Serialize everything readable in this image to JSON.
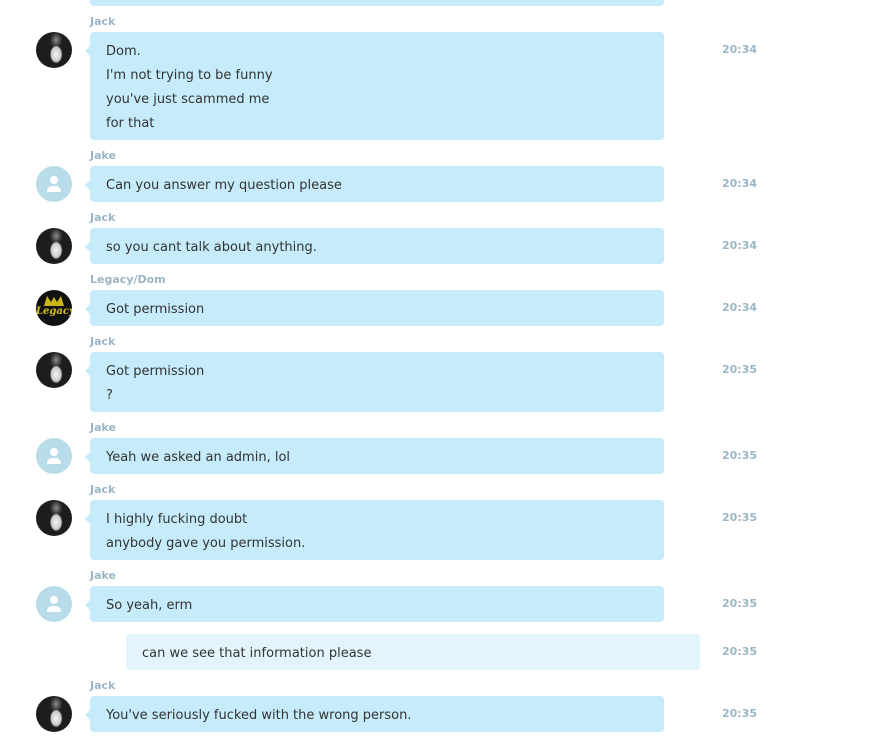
{
  "colors": {
    "bubble": "#c6ebfa",
    "own_bubble": "#e3f4fc",
    "meta_text": "#9ab5c6",
    "message_text": "#333333"
  },
  "messages": [
    {
      "sender": "Jack",
      "time": "20:34",
      "lines": [
        "Dom.",
        "I'm not trying to be funny",
        "you've just scammed me",
        "for that"
      ]
    },
    {
      "sender": "Jake",
      "time": "20:34",
      "lines": [
        "Can you answer my question please"
      ]
    },
    {
      "sender": "Jack",
      "time": "20:34",
      "lines": [
        "so you cant talk about anything."
      ]
    },
    {
      "sender": "Legacy/Dom",
      "avatar_text": "Legacy",
      "time": "20:34",
      "lines": [
        "Got permission"
      ]
    },
    {
      "sender": "Jack",
      "time": "20:35",
      "lines": [
        "Got permission",
        "?"
      ]
    },
    {
      "sender": "Jake",
      "time": "20:35",
      "lines": [
        "Yeah we asked an admin, lol"
      ]
    },
    {
      "sender": "Jack",
      "time": "20:35",
      "lines": [
        "I highly fucking doubt",
        "anybody gave you permission."
      ]
    },
    {
      "sender": "Jake",
      "time": "20:35",
      "lines": [
        "So yeah, erm"
      ]
    },
    {
      "time": "20:35",
      "lines": [
        "can we see that information please"
      ]
    },
    {
      "sender": "Jack",
      "time": "20:35",
      "lines": [
        "You've seriously fucked with the wrong person."
      ]
    }
  ]
}
